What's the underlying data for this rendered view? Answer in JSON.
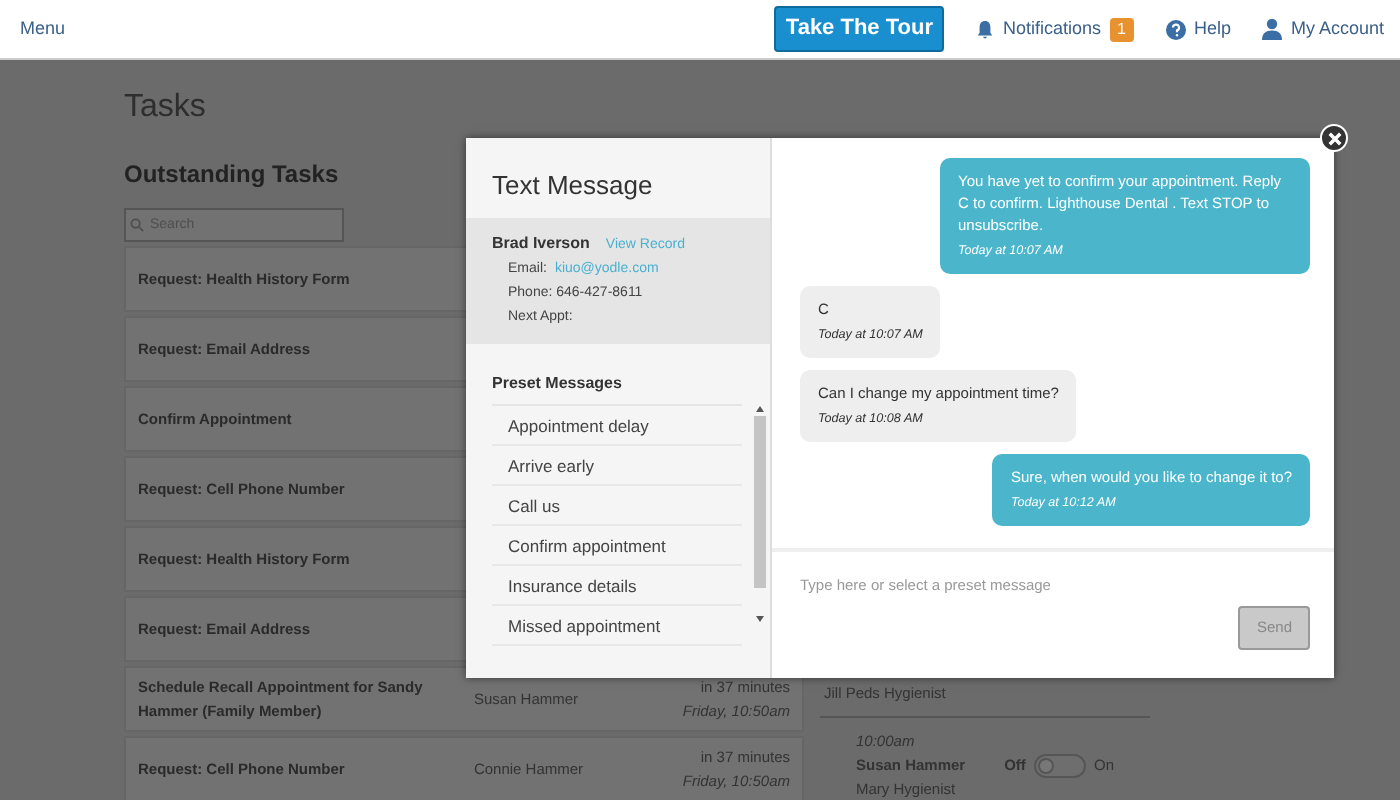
{
  "navbar": {
    "menu": "Menu",
    "tour_button": "Take The Tour",
    "notifications": {
      "label": "Notifications",
      "count": "1"
    },
    "help": "Help",
    "account": "My Account"
  },
  "page": {
    "title": "Tasks",
    "section_title": "Outstanding Tasks",
    "search": {
      "placeholder": "Search"
    },
    "tasks": [
      {
        "title": "Request: Health History Form"
      },
      {
        "title": "Request: Email Address"
      },
      {
        "title": "Confirm Appointment"
      },
      {
        "title": "Request: Cell Phone Number"
      },
      {
        "title": "Request: Health History Form"
      },
      {
        "title": "Request: Email Address"
      },
      {
        "title": "Schedule Recall Appointment for Sandy Hammer (Family Member)",
        "patient": "Susan Hammer",
        "due": "in 37 minutes",
        "when": "Friday, 10:50am"
      },
      {
        "title": "Request: Cell Phone Number",
        "patient": "Connie Hammer",
        "due": "in 37 minutes",
        "when": "Friday, 10:50am"
      }
    ]
  },
  "schedule": {
    "provider": "Jill Peds Hygienist",
    "appointment": {
      "time": "10:00am",
      "patient": "Susan Hammer",
      "off_label": "Off",
      "on_label": "On",
      "on": false,
      "provider": "Mary Hygienist"
    }
  },
  "modal": {
    "title": "Text Message",
    "contact": {
      "name": "Brad Iverson",
      "record_link": "View Record",
      "email_label": "Email:",
      "email": "kiuo@yodle.com",
      "phone": "Phone: 646-427-8611",
      "next_appt": "Next Appt:"
    },
    "presets": {
      "title": "Preset Messages",
      "items": [
        "Appointment delay",
        "Arrive early",
        "Call us",
        "Confirm appointment",
        "Insurance details",
        "Missed appointment"
      ]
    },
    "messages": [
      {
        "kind": "sent",
        "text": "You have yet to confirm your appointment. Reply C to confirm. Lighthouse Dental . Text STOP to unsubscribe.",
        "time": "Today at 10:07 AM"
      },
      {
        "kind": "received",
        "text": "C",
        "time": "Today at 10:07 AM"
      },
      {
        "kind": "received",
        "text": "Can I change my appointment time?",
        "time": "Today at 10:08 AM"
      },
      {
        "kind": "sent",
        "text": "Sure, when would you like to change it to?",
        "time": "Today at 10:12 AM"
      }
    ],
    "composer": {
      "placeholder": "Type here or select a preset message"
    },
    "send_button": {
      "label": "Send",
      "disabled": true
    }
  }
}
